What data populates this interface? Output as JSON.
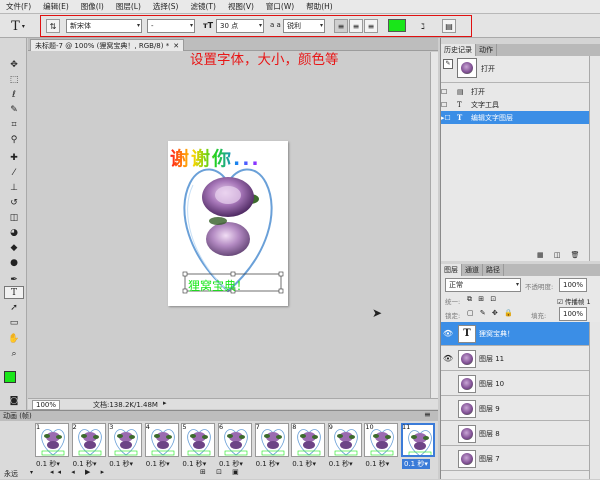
{
  "menu": [
    "文件(F)",
    "编辑(E)",
    "图像(I)",
    "图层(L)",
    "选择(S)",
    "滤镜(T)",
    "视图(V)",
    "窗口(W)",
    "帮助(H)"
  ],
  "options": {
    "tool_glyph": "T",
    "font_family": "新宋体",
    "font_style": "-",
    "font_size": "30 点",
    "aa_prefix": "a a",
    "antialias": "锐利",
    "text_color": "#19e619"
  },
  "doc": {
    "tab_title": "未标题-7 @ 100% (狸窝宝典！, RGB/8) *",
    "annotation": "设置字体，大小，颜色等",
    "art_headline": "谢谢你...",
    "art_caption": "狸窝宝典！",
    "zoom": "100%",
    "doc_size": "文档:138.2K/1.48M"
  },
  "animation": {
    "title": "动画 (帧)",
    "loop": "永远",
    "frames": [
      {
        "n": "1",
        "delay": "0.1 秒▾"
      },
      {
        "n": "2",
        "delay": "0.1 秒▾"
      },
      {
        "n": "3",
        "delay": "0.1 秒▾"
      },
      {
        "n": "4",
        "delay": "0.1 秒▾"
      },
      {
        "n": "5",
        "delay": "0.1 秒▾"
      },
      {
        "n": "6",
        "delay": "0.1 秒▾"
      },
      {
        "n": "7",
        "delay": "0.1 秒▾"
      },
      {
        "n": "8",
        "delay": "0.1 秒▾"
      },
      {
        "n": "9",
        "delay": "0.1 秒▾"
      },
      {
        "n": "10",
        "delay": "0.1 秒▾"
      },
      {
        "n": "11",
        "delay": "0.1 秒▾"
      }
    ]
  },
  "history": {
    "tab_history": "历史记录",
    "tab_actions": "动作",
    "snapshot": "打开",
    "steps": [
      "打开",
      "文字工具",
      "编辑文字图层"
    ]
  },
  "layers": {
    "tab_layers": "图层",
    "tab_channels": "通道",
    "tab_paths": "路径",
    "blend_mode": "正常",
    "opacity_label": "不透明度:",
    "opacity": "100%",
    "unify_label": "统一:",
    "propagate": "传播帧 1",
    "lock_label": "锁定:",
    "fill_label": "填充:",
    "fill": "100%",
    "items": [
      "狸窝宝典！",
      "图层 11",
      "图层 10",
      "图层 9",
      "图层 8",
      "图层 7"
    ]
  },
  "colors": {
    "accent": "#3b8ee6",
    "annotation_red": "#e81616",
    "foreground": "#19e619"
  }
}
